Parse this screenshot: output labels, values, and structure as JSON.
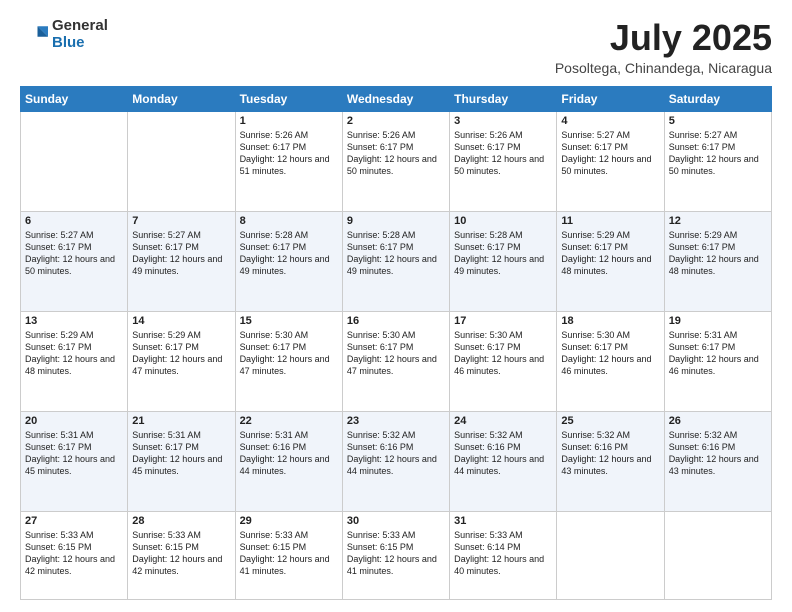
{
  "logo": {
    "general": "General",
    "blue": "Blue"
  },
  "title": "July 2025",
  "location": "Posoltega, Chinandega, Nicaragua",
  "headers": [
    "Sunday",
    "Monday",
    "Tuesday",
    "Wednesday",
    "Thursday",
    "Friday",
    "Saturday"
  ],
  "weeks": [
    [
      {
        "day": "",
        "info": ""
      },
      {
        "day": "",
        "info": ""
      },
      {
        "day": "1",
        "info": "Sunrise: 5:26 AM\nSunset: 6:17 PM\nDaylight: 12 hours and 51 minutes."
      },
      {
        "day": "2",
        "info": "Sunrise: 5:26 AM\nSunset: 6:17 PM\nDaylight: 12 hours and 50 minutes."
      },
      {
        "day": "3",
        "info": "Sunrise: 5:26 AM\nSunset: 6:17 PM\nDaylight: 12 hours and 50 minutes."
      },
      {
        "day": "4",
        "info": "Sunrise: 5:27 AM\nSunset: 6:17 PM\nDaylight: 12 hours and 50 minutes."
      },
      {
        "day": "5",
        "info": "Sunrise: 5:27 AM\nSunset: 6:17 PM\nDaylight: 12 hours and 50 minutes."
      }
    ],
    [
      {
        "day": "6",
        "info": "Sunrise: 5:27 AM\nSunset: 6:17 PM\nDaylight: 12 hours and 50 minutes."
      },
      {
        "day": "7",
        "info": "Sunrise: 5:27 AM\nSunset: 6:17 PM\nDaylight: 12 hours and 49 minutes."
      },
      {
        "day": "8",
        "info": "Sunrise: 5:28 AM\nSunset: 6:17 PM\nDaylight: 12 hours and 49 minutes."
      },
      {
        "day": "9",
        "info": "Sunrise: 5:28 AM\nSunset: 6:17 PM\nDaylight: 12 hours and 49 minutes."
      },
      {
        "day": "10",
        "info": "Sunrise: 5:28 AM\nSunset: 6:17 PM\nDaylight: 12 hours and 49 minutes."
      },
      {
        "day": "11",
        "info": "Sunrise: 5:29 AM\nSunset: 6:17 PM\nDaylight: 12 hours and 48 minutes."
      },
      {
        "day": "12",
        "info": "Sunrise: 5:29 AM\nSunset: 6:17 PM\nDaylight: 12 hours and 48 minutes."
      }
    ],
    [
      {
        "day": "13",
        "info": "Sunrise: 5:29 AM\nSunset: 6:17 PM\nDaylight: 12 hours and 48 minutes."
      },
      {
        "day": "14",
        "info": "Sunrise: 5:29 AM\nSunset: 6:17 PM\nDaylight: 12 hours and 47 minutes."
      },
      {
        "day": "15",
        "info": "Sunrise: 5:30 AM\nSunset: 6:17 PM\nDaylight: 12 hours and 47 minutes."
      },
      {
        "day": "16",
        "info": "Sunrise: 5:30 AM\nSunset: 6:17 PM\nDaylight: 12 hours and 47 minutes."
      },
      {
        "day": "17",
        "info": "Sunrise: 5:30 AM\nSunset: 6:17 PM\nDaylight: 12 hours and 46 minutes."
      },
      {
        "day": "18",
        "info": "Sunrise: 5:30 AM\nSunset: 6:17 PM\nDaylight: 12 hours and 46 minutes."
      },
      {
        "day": "19",
        "info": "Sunrise: 5:31 AM\nSunset: 6:17 PM\nDaylight: 12 hours and 46 minutes."
      }
    ],
    [
      {
        "day": "20",
        "info": "Sunrise: 5:31 AM\nSunset: 6:17 PM\nDaylight: 12 hours and 45 minutes."
      },
      {
        "day": "21",
        "info": "Sunrise: 5:31 AM\nSunset: 6:17 PM\nDaylight: 12 hours and 45 minutes."
      },
      {
        "day": "22",
        "info": "Sunrise: 5:31 AM\nSunset: 6:16 PM\nDaylight: 12 hours and 44 minutes."
      },
      {
        "day": "23",
        "info": "Sunrise: 5:32 AM\nSunset: 6:16 PM\nDaylight: 12 hours and 44 minutes."
      },
      {
        "day": "24",
        "info": "Sunrise: 5:32 AM\nSunset: 6:16 PM\nDaylight: 12 hours and 44 minutes."
      },
      {
        "day": "25",
        "info": "Sunrise: 5:32 AM\nSunset: 6:16 PM\nDaylight: 12 hours and 43 minutes."
      },
      {
        "day": "26",
        "info": "Sunrise: 5:32 AM\nSunset: 6:16 PM\nDaylight: 12 hours and 43 minutes."
      }
    ],
    [
      {
        "day": "27",
        "info": "Sunrise: 5:33 AM\nSunset: 6:15 PM\nDaylight: 12 hours and 42 minutes."
      },
      {
        "day": "28",
        "info": "Sunrise: 5:33 AM\nSunset: 6:15 PM\nDaylight: 12 hours and 42 minutes."
      },
      {
        "day": "29",
        "info": "Sunrise: 5:33 AM\nSunset: 6:15 PM\nDaylight: 12 hours and 41 minutes."
      },
      {
        "day": "30",
        "info": "Sunrise: 5:33 AM\nSunset: 6:15 PM\nDaylight: 12 hours and 41 minutes."
      },
      {
        "day": "31",
        "info": "Sunrise: 5:33 AM\nSunset: 6:14 PM\nDaylight: 12 hours and 40 minutes."
      },
      {
        "day": "",
        "info": ""
      },
      {
        "day": "",
        "info": ""
      }
    ]
  ]
}
